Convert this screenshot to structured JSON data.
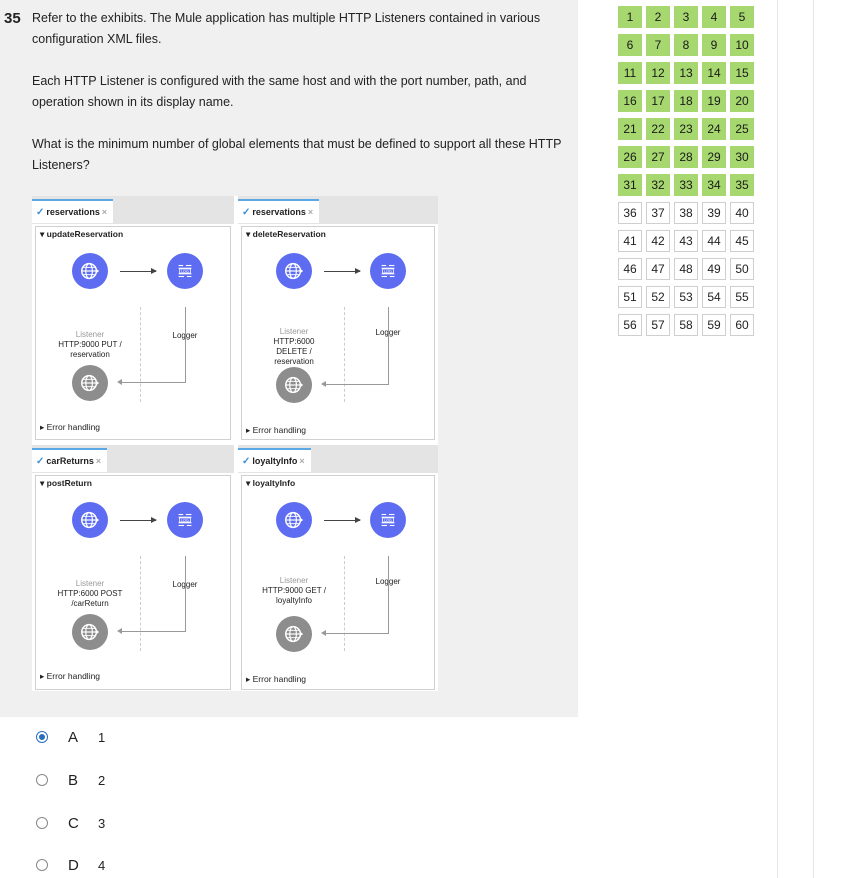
{
  "question": {
    "number": "35",
    "paragraphs": [
      "Refer to the exhibits. The Mule application has multiple HTTP Listeners contained in various configuration XML files.",
      "Each HTTP Listener is configured with the same host and with the port number, path, and operation shown in its display name.",
      "What is the minimum number of global elements that must be defined to support all these HTTP Listeners?"
    ]
  },
  "exhibit": {
    "flows": [
      {
        "tab": "reservations",
        "flow": "updateReservation",
        "listener": "Listener",
        "desc1": "HTTP:9000 PUT /",
        "desc2": "reservation",
        "desc3": "",
        "logger": "Logger",
        "error": "Error handling"
      },
      {
        "tab": "reservations",
        "flow": "deleteReservation",
        "listener": "Listener",
        "desc1": "HTTP:6000",
        "desc2": "DELETE /",
        "desc3": "reservation",
        "logger": "Logger",
        "error": "Error handling"
      },
      {
        "tab": "carReturns",
        "flow": "postReturn",
        "listener": "Listener",
        "desc1": "HTTP:6000 POST",
        "desc2": "/carReturn",
        "desc3": "",
        "logger": "Logger",
        "error": "Error handling"
      },
      {
        "tab": "loyaltyInfo",
        "flow": "loyaltyInfo",
        "listener": "Listener",
        "desc1": "HTTP:9000 GET /",
        "desc2": "loyaltyInfo",
        "desc3": "",
        "logger": "Logger",
        "error": "Error handling"
      }
    ],
    "log_icon_text": "LOG",
    "tab_close": "×"
  },
  "options": [
    {
      "letter": "A",
      "value": "1",
      "selected": true
    },
    {
      "letter": "B",
      "value": "2",
      "selected": false
    },
    {
      "letter": "C",
      "value": "3",
      "selected": false
    },
    {
      "letter": "D",
      "value": "4",
      "selected": false
    }
  ],
  "navigation": {
    "answered_through": 35,
    "total": 60,
    "answered_color": "#a6d86f",
    "numbers": [
      "1",
      "2",
      "3",
      "4",
      "5",
      "6",
      "7",
      "8",
      "9",
      "10",
      "11",
      "12",
      "13",
      "14",
      "15",
      "16",
      "17",
      "18",
      "19",
      "20",
      "21",
      "22",
      "23",
      "24",
      "25",
      "26",
      "27",
      "28",
      "29",
      "30",
      "31",
      "32",
      "33",
      "34",
      "35",
      "36",
      "37",
      "38",
      "39",
      "40",
      "41",
      "42",
      "43",
      "44",
      "45",
      "46",
      "47",
      "48",
      "49",
      "50",
      "51",
      "52",
      "53",
      "54",
      "55",
      "56",
      "57",
      "58",
      "59",
      "60"
    ]
  },
  "colors": {
    "listener_blue": "#5d6cf0",
    "error_gray": "#8d8d8d",
    "selected_radio": "#2a6ebb",
    "panel_bg": "#f0f0f0"
  }
}
